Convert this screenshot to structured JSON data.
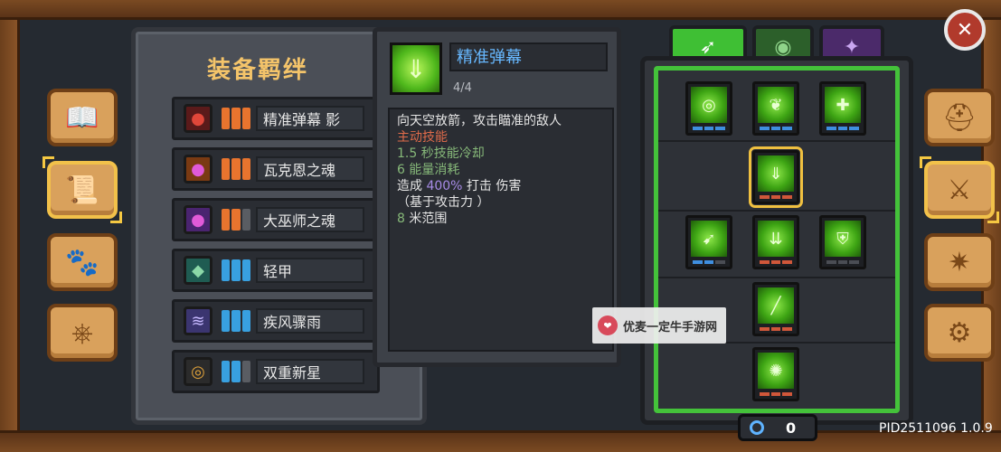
{
  "panel_title": "装备羁绊",
  "sets": [
    {
      "name": "精准弹幕 影",
      "icon": "red-orb-icon",
      "icon_color": "#c0392b",
      "bar_color": "#e8742e",
      "pips": "orange"
    },
    {
      "name": "瓦克恩之魂",
      "icon": "purple-flame-icon",
      "icon_color": "#c9732b",
      "bar_color": "#e8742e",
      "pips": "orange"
    },
    {
      "name": "大巫师之魂",
      "icon": "purple-flame-icon",
      "icon_color": "#7a3fb8",
      "bar_color": "#e8742e",
      "pips": "orange"
    },
    {
      "name": "轻甲",
      "icon": "armor-icon",
      "icon_color": "#2f8f7a",
      "bar_color": "#38a0e0",
      "pips": "blue"
    },
    {
      "name": "疾风骤雨",
      "icon": "whirlwind-icon",
      "icon_color": "#6a5bb8",
      "bar_color": "#38a0e0",
      "pips": "blue"
    },
    {
      "name": "双重新星",
      "icon": "nova-icon",
      "icon_color": "#3a3a3a",
      "bar_color": "#38a0e0",
      "pips": "blue"
    }
  ],
  "skill": {
    "name": "精准弹幕",
    "level": "4/4",
    "desc_line1": "向天空放箭，攻击瞄准的敌人",
    "desc_type": "主动技能",
    "cooldown_num": "1.5",
    "cooldown_text": " 秒技能冷却",
    "energy_num": "6",
    "energy_text": " 能量消耗",
    "dmg_pre": "造成 ",
    "dmg_pct": "400%",
    "dmg_post": " 打击 伤害",
    "dmg_note": "（基于攻击力 ）",
    "range_num": "8",
    "range_text": " 米范围"
  },
  "tabs": [
    {
      "name": "bow-tab",
      "icon": "bow-icon",
      "active": true
    },
    {
      "name": "nature-tab",
      "icon": "leaf-swirl-icon",
      "active": false
    },
    {
      "name": "arcane-tab",
      "icon": "rune-icon",
      "active": false
    }
  ],
  "energy_value": "0",
  "watermark": "优麦一定牛手游网",
  "version": "PID2511096 1.0.9"
}
